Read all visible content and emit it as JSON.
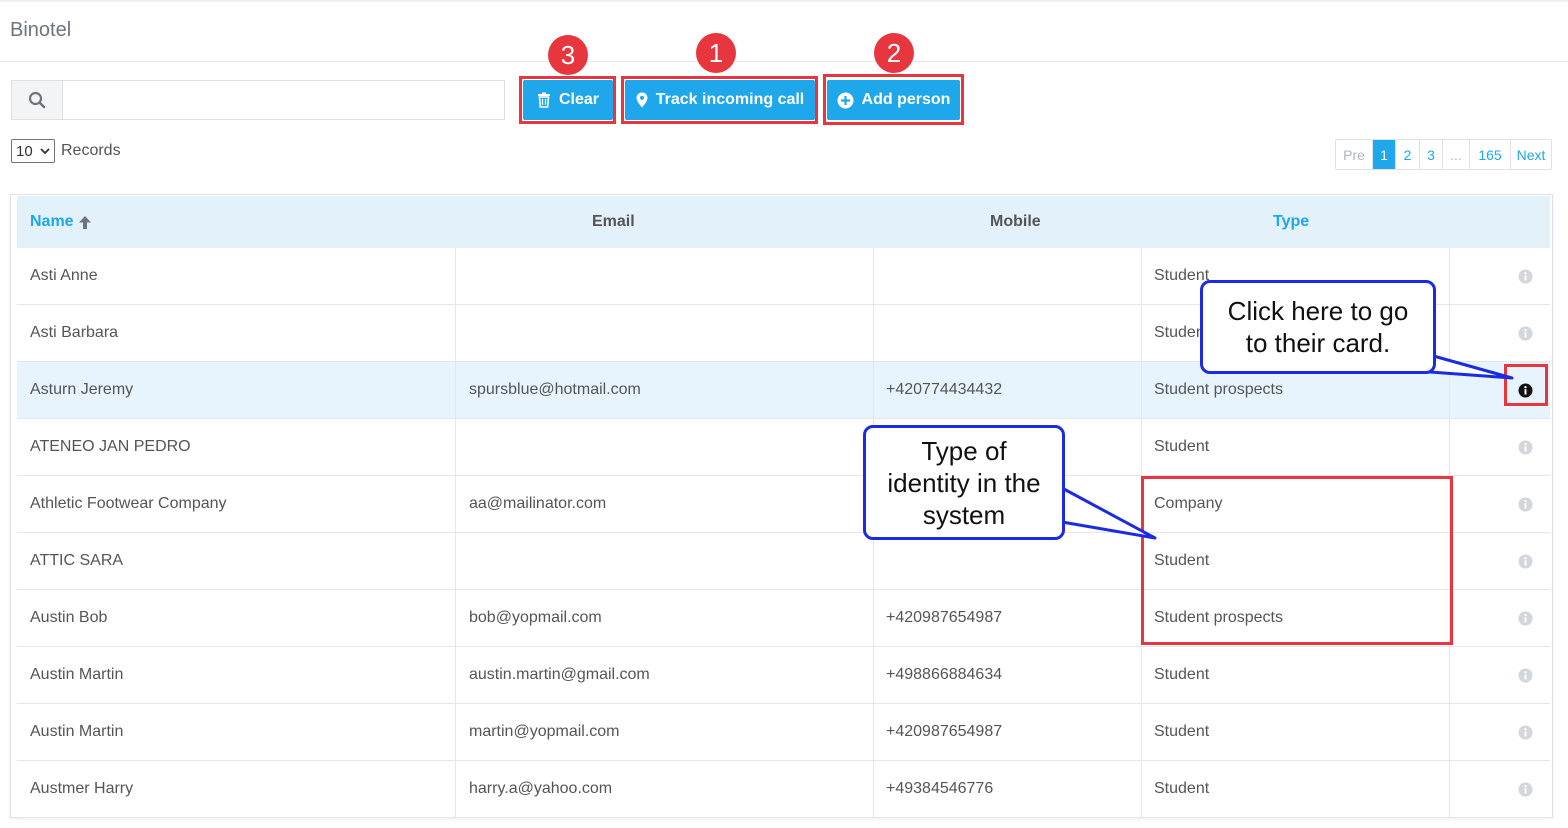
{
  "app": {
    "title": "Binotel"
  },
  "search": {
    "placeholder": "",
    "value": ""
  },
  "toolbar": {
    "clear_label": "Clear",
    "track_label": "Track incoming call",
    "add_label": "Add person"
  },
  "annotations": {
    "badge_clear": "3",
    "badge_track": "1",
    "badge_add": "2",
    "callout_card_line1": "Click here to go",
    "callout_card_line2": "to their card.",
    "callout_type_line1": "Type of",
    "callout_type_line2": "identity in the",
    "callout_type_line3": "system",
    "highlight_color": "#e8363f",
    "callout_border_color": "#1b2be0"
  },
  "records": {
    "per_page": "10",
    "label": "Records"
  },
  "pagination": {
    "prev": "Pre",
    "pages": [
      "1",
      "2",
      "3",
      "...",
      "165"
    ],
    "active": "1",
    "next": "Next"
  },
  "table": {
    "columns": {
      "name": "Name",
      "email": "Email",
      "mobile": "Mobile",
      "type": "Type"
    },
    "rows": [
      {
        "name": "Asti Anne",
        "email": "",
        "mobile": "",
        "type": "Student"
      },
      {
        "name": "Asti Barbara",
        "email": "",
        "mobile": "",
        "type": "Student"
      },
      {
        "name": "Asturn Jeremy",
        "email": "spursblue@hotmail.com",
        "mobile": "+420774434432",
        "type": "Student prospects"
      },
      {
        "name": "ATENEO JAN PEDRO",
        "email": "",
        "mobile": "",
        "type": "Student"
      },
      {
        "name": "Athletic Footwear Company",
        "email": "aa@mailinator.com",
        "mobile": "",
        "type": "Company"
      },
      {
        "name": "ATTIC SARA",
        "email": "",
        "mobile": "",
        "type": "Student"
      },
      {
        "name": "Austin Bob",
        "email": "bob@yopmail.com",
        "mobile": "+420987654987",
        "type": "Student prospects"
      },
      {
        "name": "Austin Martin",
        "email": "austin.martin@gmail.com",
        "mobile": "+498866884634",
        "type": "Student"
      },
      {
        "name": "Austin Martin",
        "email": "martin@yopmail.com",
        "mobile": "+420987654987",
        "type": "Student"
      },
      {
        "name": "Austmer Harry",
        "email": "harry.a@yahoo.com",
        "mobile": "+49384546776",
        "type": "Student"
      }
    ]
  },
  "colors": {
    "accent": "#1ea7ea",
    "header_bg": "#e3f1fb",
    "selected_row_bg": "#e8f4fd"
  }
}
